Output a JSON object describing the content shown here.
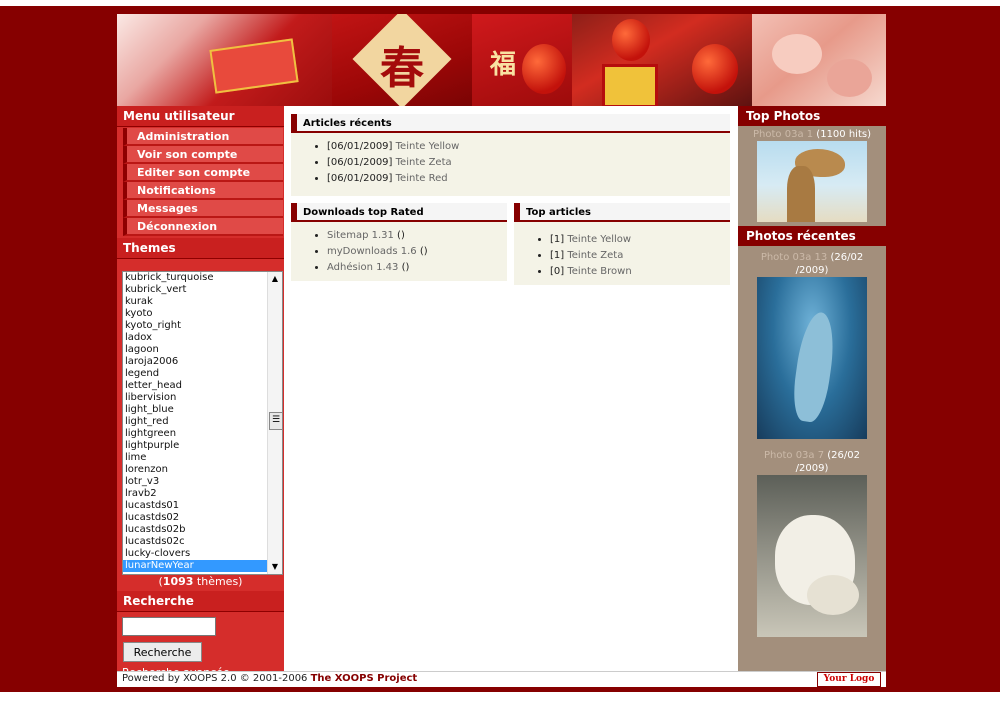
{
  "banner": {
    "glyphs": [
      "春",
      "福"
    ]
  },
  "user_menu": {
    "title": "Menu utilisateur",
    "items": [
      "Administration",
      "Voir son compte",
      "Editer son compte",
      "Notifications",
      "Messages",
      "Déconnexion"
    ]
  },
  "themes": {
    "title": "Themes",
    "items": [
      "kubrick_turquoise",
      "kubrick_vert",
      "kurak",
      "kyoto",
      "kyoto_right",
      "ladox",
      "lagoon",
      "laroja2006",
      "legend",
      "letter_head",
      "libervision",
      "light_blue",
      "light_red",
      "lightgreen",
      "lightpurple",
      "lime",
      "lorenzon",
      "lotr_v3",
      "lravb2",
      "lucastds01",
      "lucastds02",
      "lucastds02b",
      "lucastds02c",
      "lucky-clovers",
      "lunarNewYear"
    ],
    "selected": "lunarNewYear",
    "count_prefix": "(",
    "count": "1093",
    "count_suffix": " thèmes)"
  },
  "search": {
    "title": "Recherche",
    "value": "",
    "button": "Recherche",
    "advanced": "Recherche avancée"
  },
  "articles_recents": {
    "title": "Articles récents",
    "items": [
      {
        "date": "[06/01/2009]",
        "link": "Teinte Yellow"
      },
      {
        "date": "[06/01/2009]",
        "link": "Teinte Zeta"
      },
      {
        "date": "[06/01/2009]",
        "link": "Teinte Red"
      }
    ]
  },
  "downloads": {
    "title": "Downloads top Rated",
    "items": [
      {
        "link": "Sitemap 1.31",
        "suffix": " ()"
      },
      {
        "link": "myDownloads 1.6",
        "suffix": " ()"
      },
      {
        "link": "Adhésion 1.43",
        "suffix": " ()"
      }
    ]
  },
  "top_articles": {
    "title": "Top articles",
    "items": [
      {
        "count": "[1]",
        "link": "Teinte Yellow"
      },
      {
        "count": "[1]",
        "link": "Teinte Zeta"
      },
      {
        "count": "[0]",
        "link": "Teinte Brown"
      }
    ]
  },
  "top_photos": {
    "title": "Top Photos",
    "photo": {
      "name": "Photo 03a 1",
      "info": " (1100 hits)"
    }
  },
  "recent_photos": {
    "title": "Photos récentes",
    "photos": [
      {
        "name": "Photo 03a 13",
        "info1": " (26/02",
        "info2": "/2009)"
      },
      {
        "name": "Photo 03a 7",
        "info1": " (26/02",
        "info2": "/2009)"
      }
    ]
  },
  "footer": {
    "powered": "Powered by XOOPS 2.0 © 2001-2006 ",
    "project": "The XOOPS Project",
    "logo": "Your Logo"
  },
  "colors": {
    "page_bg": "#860000",
    "left_bg": "#d52d2b",
    "right_bg": "#a38f7c",
    "block_bg": "#f4f3e7"
  }
}
